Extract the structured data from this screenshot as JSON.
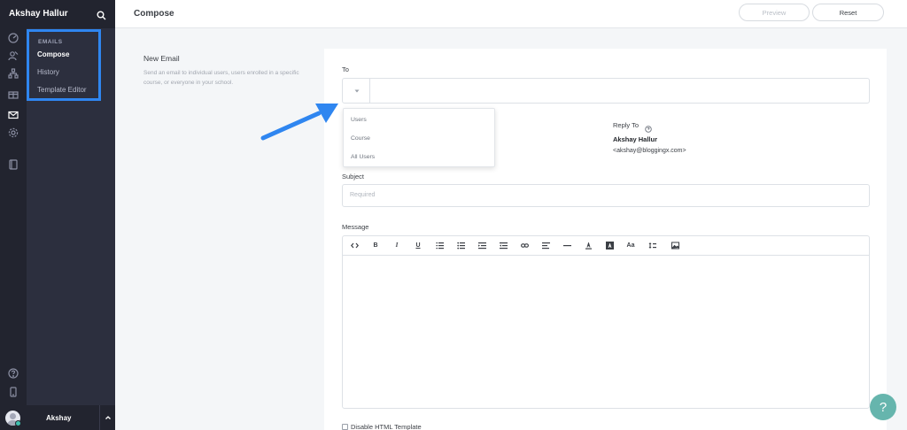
{
  "sidebar": {
    "school_name": "Akshay Hallur",
    "section_label": "EMAILS",
    "items": [
      {
        "label": "Compose",
        "active": true
      },
      {
        "label": "History",
        "active": false
      },
      {
        "label": "Template Editor",
        "active": false
      }
    ],
    "user_name": "Akshay"
  },
  "topbar": {
    "title": "Compose",
    "preview_label": "Preview",
    "reset_label": "Reset"
  },
  "intro": {
    "title": "New Email",
    "description": "Send an email to individual users, users enrolled in a specific course, or everyone in your school."
  },
  "form": {
    "to_label": "To",
    "to_options": [
      "Users",
      "Course",
      "All Users"
    ],
    "reply_to_label": "Reply To",
    "reply_to_name": "Akshay Hallur",
    "reply_to_email": "<akshay@bloggingx.com>",
    "subject_label": "Subject",
    "subject_placeholder": "Required",
    "message_label": "Message",
    "toolbar": {
      "bold": "B",
      "italic": "I",
      "underline": "U",
      "font_size": "Aa"
    },
    "disable_html_label": "Disable HTML Template"
  },
  "help_label": "?",
  "colors": {
    "accent_blue": "#2f86f0",
    "help_button": "#66b5ad",
    "sidebar_bg": "#2c2f3e",
    "rail_bg": "#22242f"
  }
}
